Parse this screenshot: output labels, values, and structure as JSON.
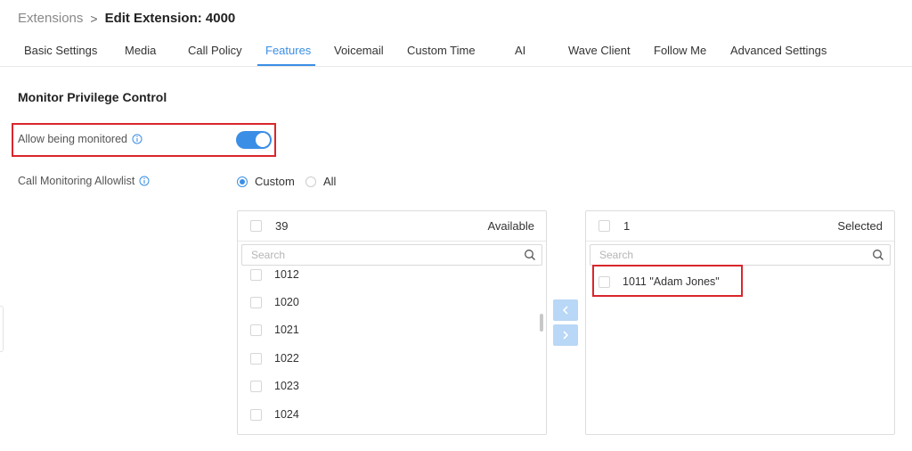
{
  "breadcrumb": {
    "parent": "Extensions",
    "separator": ">",
    "current": "Edit Extension: 4000"
  },
  "tabs": [
    {
      "label": "Basic Settings",
      "active": false
    },
    {
      "label": "Media",
      "active": false
    },
    {
      "label": "Call Policy",
      "active": false
    },
    {
      "label": "Features",
      "active": true
    },
    {
      "label": "Voicemail",
      "active": false
    },
    {
      "label": "Custom Time",
      "active": false
    },
    {
      "label": "AI",
      "active": false
    },
    {
      "label": "Wave Client",
      "active": false
    },
    {
      "label": "Follow Me",
      "active": false
    },
    {
      "label": "Advanced Settings",
      "active": false
    }
  ],
  "section": {
    "title": "Monitor Privilege Control"
  },
  "allow_monitored": {
    "label": "Allow being monitored",
    "enabled": true
  },
  "allowlist": {
    "label": "Call Monitoring Allowlist",
    "options": [
      {
        "label": "Custom",
        "selected": true
      },
      {
        "label": "All",
        "selected": false
      }
    ]
  },
  "available": {
    "count": "39",
    "title": "Available",
    "search_placeholder": "Search",
    "items": [
      "1012",
      "1020",
      "1021",
      "1022",
      "1023",
      "1024"
    ]
  },
  "selected": {
    "count": "1",
    "title": "Selected",
    "search_placeholder": "Search",
    "items": [
      "1011 \"Adam Jones\""
    ]
  },
  "colors": {
    "accent": "#3a8ee6",
    "highlight": "#d9262c",
    "arrow_bg": "#b9d7f6"
  },
  "icons": {
    "info": "info-icon",
    "search": "search-icon",
    "left": "chevron-left-icon",
    "right": "chevron-right-icon"
  }
}
